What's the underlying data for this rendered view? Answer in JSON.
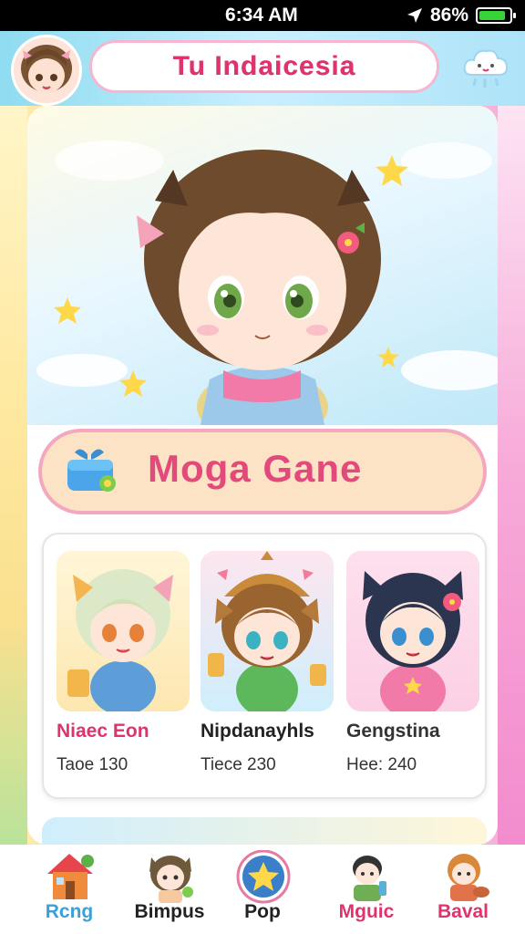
{
  "status": {
    "time": "6:34 AM",
    "battery": "86%",
    "battery_fraction": 0.86
  },
  "header": {
    "title": "Tu Indaicesia"
  },
  "banner": {
    "title": "Moga Gane"
  },
  "characters": [
    {
      "name": "Niaec Eon",
      "stat": "Taoe 130",
      "name_color": "#e0336e"
    },
    {
      "name": "Nipdanayhls",
      "stat": "Tiece 230",
      "name_color": "#222222"
    },
    {
      "name": "Gengstina",
      "stat": "Hee: 240",
      "name_color": "#333333"
    }
  ],
  "nav": [
    {
      "label": "Rcng",
      "icon": "house-icon",
      "color": "#3aa0d8"
    },
    {
      "label": "Bimpus",
      "icon": "cat-character-icon",
      "color": "#222222"
    },
    {
      "label": "Pop",
      "icon": "star-badge-icon",
      "color": "#222222"
    },
    {
      "label": "Mguic",
      "icon": "boy-character-icon",
      "color": "#e0336e"
    },
    {
      "label": "Baval",
      "icon": "girl-character-icon",
      "color": "#e0336e"
    }
  ],
  "colors": {
    "accent_pink": "#e0336e",
    "header_blue": "#8fdcf0",
    "banner_fill": "#fde3c6"
  }
}
